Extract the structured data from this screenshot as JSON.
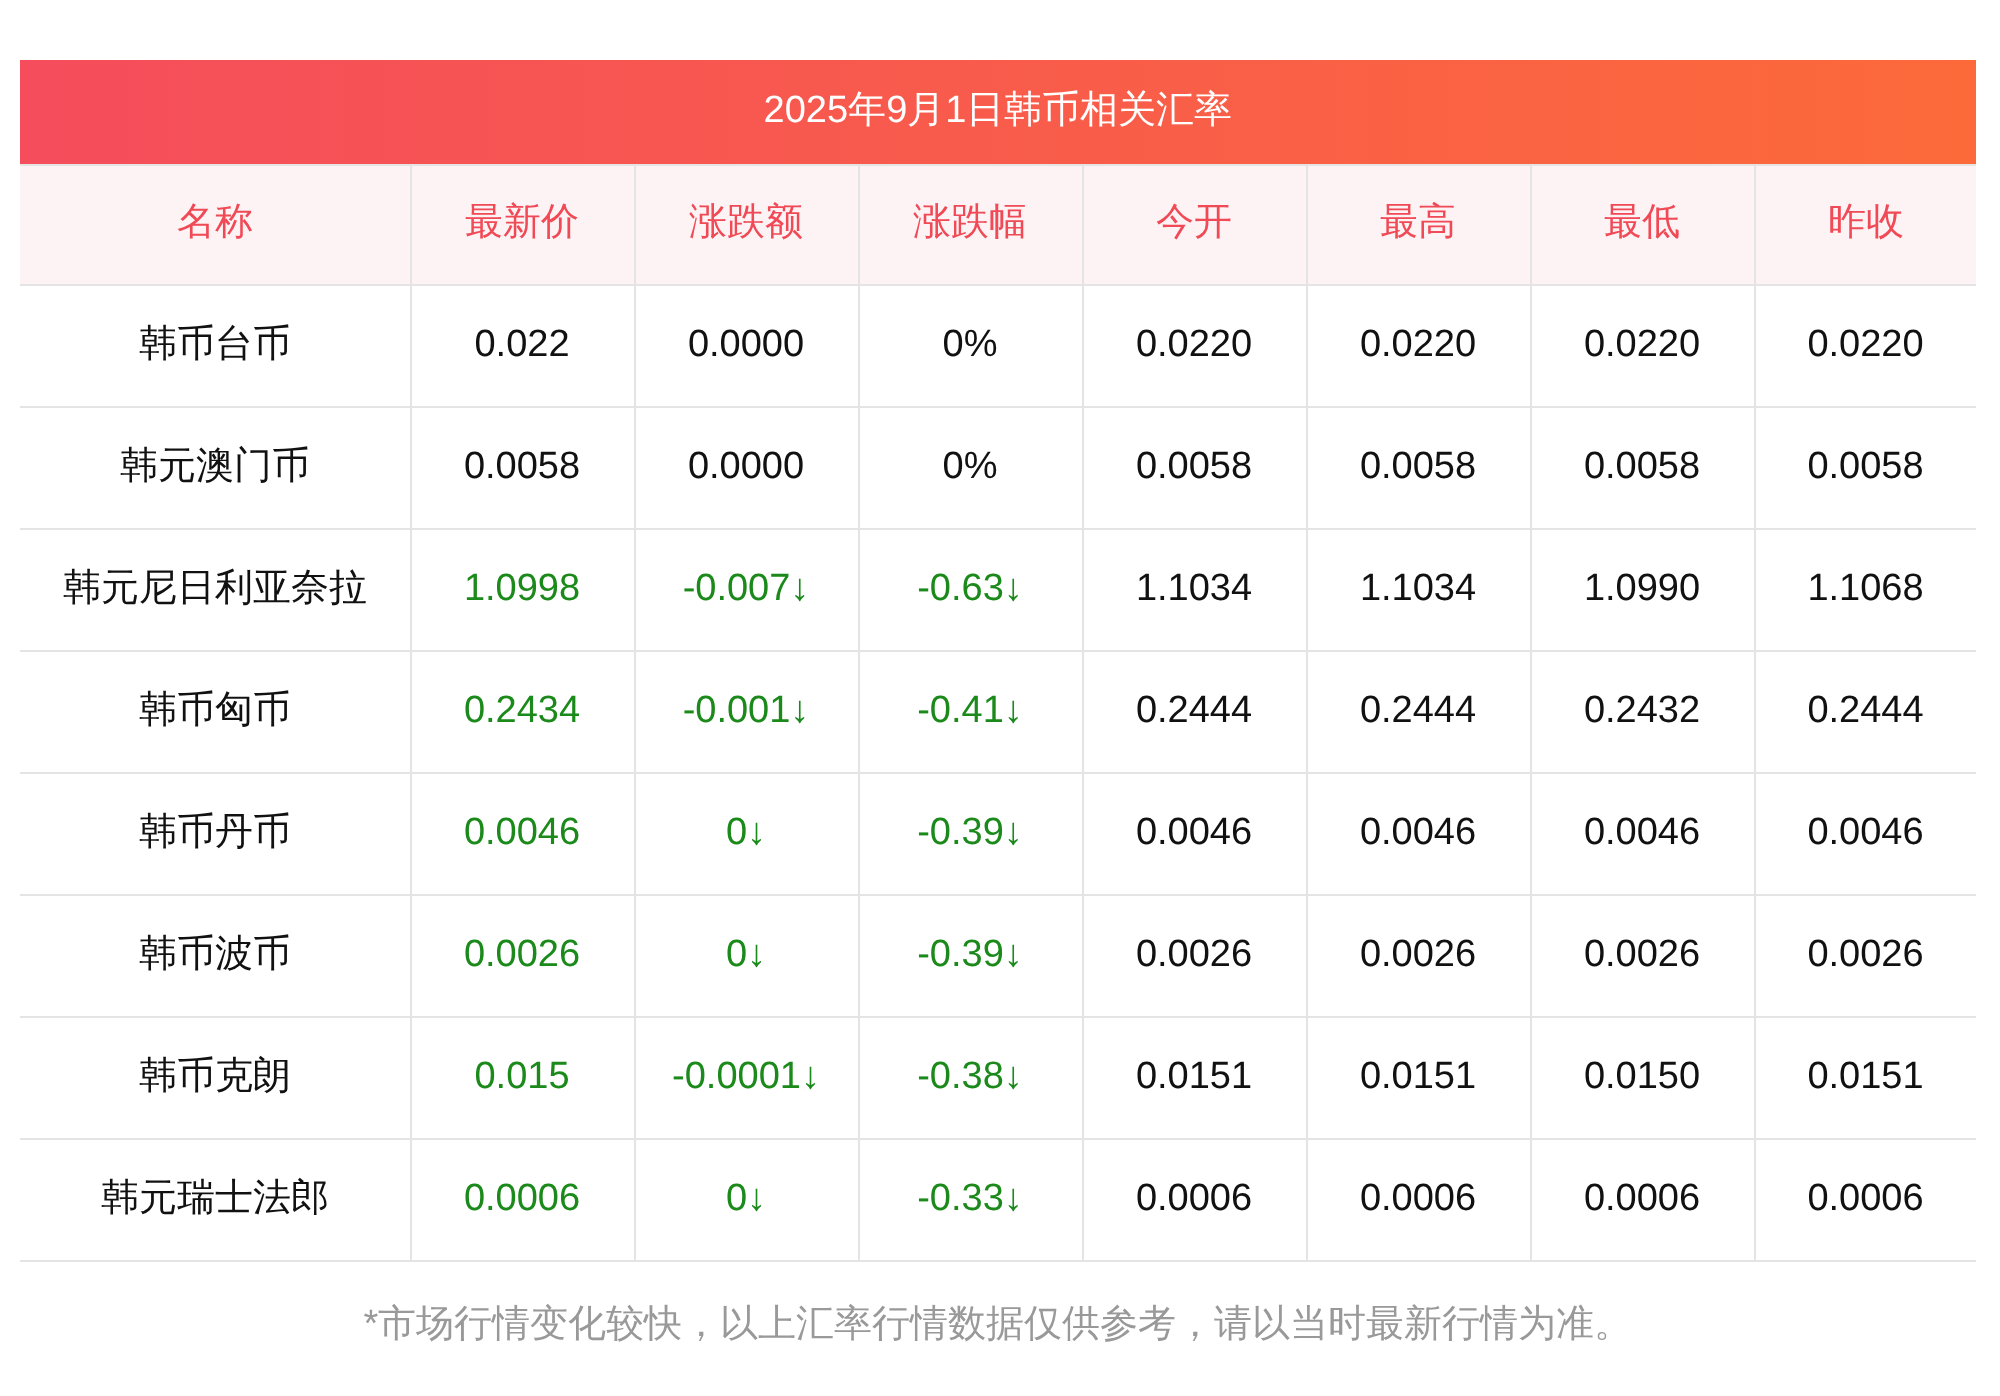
{
  "title": "2025年9月1日韩币相关汇率",
  "columns": [
    "名称",
    "最新价",
    "涨跌额",
    "涨跌幅",
    "今开",
    "最高",
    "最低",
    "昨收"
  ],
  "rows": [
    {
      "falling": false,
      "cells": [
        "韩币台币",
        "0.022",
        "0.0000",
        "0%",
        "0.0220",
        "0.0220",
        "0.0220",
        "0.0220"
      ]
    },
    {
      "falling": false,
      "cells": [
        "韩元澳门币",
        "0.0058",
        "0.0000",
        "0%",
        "0.0058",
        "0.0058",
        "0.0058",
        "0.0058"
      ]
    },
    {
      "falling": true,
      "cells": [
        "韩元尼日利亚奈拉",
        "1.0998",
        "-0.007↓",
        "-0.63↓",
        "1.1034",
        "1.1034",
        "1.0990",
        "1.1068"
      ]
    },
    {
      "falling": true,
      "cells": [
        "韩币匈币",
        "0.2434",
        "-0.001↓",
        "-0.41↓",
        "0.2444",
        "0.2444",
        "0.2432",
        "0.2444"
      ]
    },
    {
      "falling": true,
      "cells": [
        "韩币丹币",
        "0.0046",
        "0↓",
        "-0.39↓",
        "0.0046",
        "0.0046",
        "0.0046",
        "0.0046"
      ]
    },
    {
      "falling": true,
      "cells": [
        "韩币波币",
        "0.0026",
        "0↓",
        "-0.39↓",
        "0.0026",
        "0.0026",
        "0.0026",
        "0.0026"
      ]
    },
    {
      "falling": true,
      "cells": [
        "韩币克朗",
        "0.015",
        "-0.0001↓",
        "-0.38↓",
        "0.0151",
        "0.0151",
        "0.0150",
        "0.0151"
      ]
    },
    {
      "falling": true,
      "cells": [
        "韩元瑞士法郎",
        "0.0006",
        "0↓",
        "-0.33↓",
        "0.0006",
        "0.0006",
        "0.0006",
        "0.0006"
      ]
    }
  ],
  "footnote": "*市场行情变化较快，以上汇率行情数据仅供参考，请以当时最新行情为准。"
}
